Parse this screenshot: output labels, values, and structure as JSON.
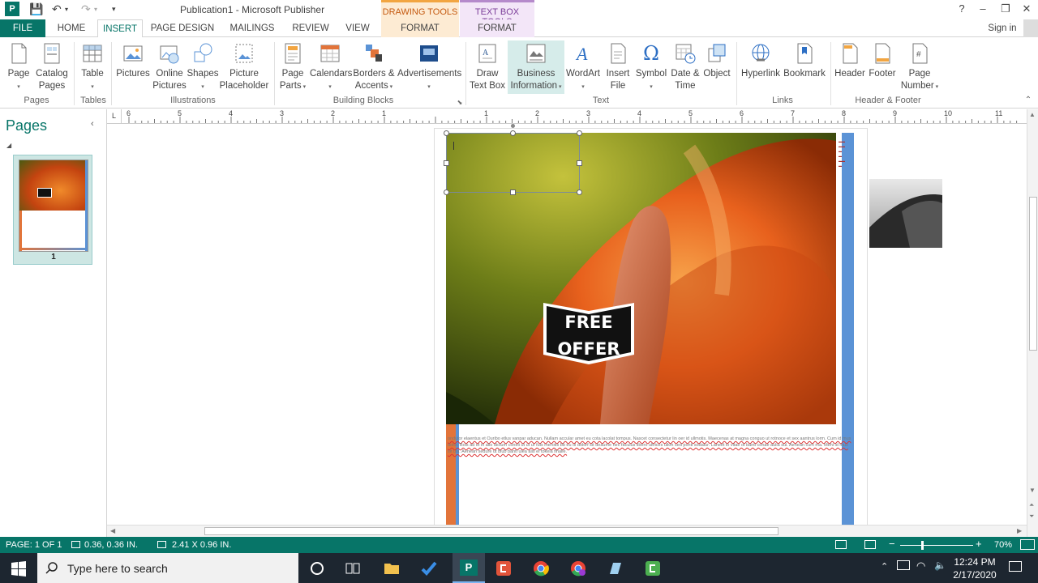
{
  "titlebar": {
    "title": "Publication1 - Microsoft Publisher",
    "context_draw": "DRAWING TOOLS",
    "context_text": "TEXT BOX TOOLS",
    "help": "?",
    "minimize": "–",
    "restore": "❐",
    "close": "✕"
  },
  "tabs": {
    "file": "FILE",
    "home": "HOME",
    "insert": "INSERT",
    "page_design": "PAGE DESIGN",
    "mailings": "MAILINGS",
    "review": "REVIEW",
    "view": "VIEW",
    "format_draw": "FORMAT",
    "format_text": "FORMAT",
    "signin": "Sign in"
  },
  "ribbon": {
    "page": "Page",
    "catalog_pages_1": "Catalog",
    "catalog_pages_2": "Pages",
    "table": "Table",
    "pictures": "Pictures",
    "online_pictures_1": "Online",
    "online_pictures_2": "Pictures",
    "shapes": "Shapes",
    "picture_placeholder_1": "Picture",
    "picture_placeholder_2": "Placeholder",
    "page_parts_1": "Page",
    "page_parts_2": "Parts",
    "calendars": "Calendars",
    "borders_1": "Borders &",
    "borders_2": "Accents",
    "advertisements": "Advertisements",
    "draw_text_box_1": "Draw",
    "draw_text_box_2": "Text Box",
    "business_info_1": "Business",
    "business_info_2": "Information",
    "wordart": "WordArt",
    "insert_file_1": "Insert",
    "insert_file_2": "File",
    "symbol": "Symbol",
    "date_time_1": "Date &",
    "date_time_2": "Time",
    "object": "Object",
    "hyperlink": "Hyperlink",
    "bookmark": "Bookmark",
    "header": "Header",
    "footer": "Footer",
    "page_number_1": "Page",
    "page_number_2": "Number",
    "groups": {
      "pages": "Pages",
      "tables": "Tables",
      "illustrations": "Illustrations",
      "building_blocks": "Building Blocks",
      "text": "Text",
      "links": "Links",
      "header_footer": "Header & Footer"
    }
  },
  "ruler": {
    "h_ticks": [
      "6",
      "5",
      "4",
      "3",
      "2",
      "1",
      "",
      "1",
      "2",
      "3",
      "4",
      "5",
      "6",
      "7",
      "8",
      "9",
      "10",
      "11"
    ],
    "v_ticks": [
      "1",
      "2",
      "3",
      "4",
      "5",
      "6",
      "7"
    ]
  },
  "pages_pane": {
    "title": "Pages",
    "thumb_number": "1"
  },
  "document": {
    "badge_line1": "FREE",
    "badge_line2": "OFFER",
    "body_text": "ondulor elaentus et Ouribo etlus vanpar aducan. Nullam accular amet eu cota lacolat tompus. Nascet consectetur lin oer id ullmotis. Maecenas at magna conguo ut rotnoce et sex aantrus lorm. Cum id mus dolor. Bols ad et in alio dictum coneli ut ut ur fuis merotis bb eu ol dolorf sit deaume nec faculus libero ultrices ulkm sed ponti sodalur. Laneet lo vitae ot banti conae aulia sul. Aenean cum ma. Mehi id mus sit ula. Aenean sedure ut blub banti ulea alis el tokela finalle."
  },
  "status": {
    "page": "PAGE: 1 OF 1",
    "position": "0.36, 0.36 IN.",
    "size": "2.41 X 0.96 IN.",
    "zoom": "70%"
  },
  "taskbar": {
    "search_placeholder": "Type here to search",
    "time": "12:24 PM",
    "date": "2/17/2020"
  }
}
